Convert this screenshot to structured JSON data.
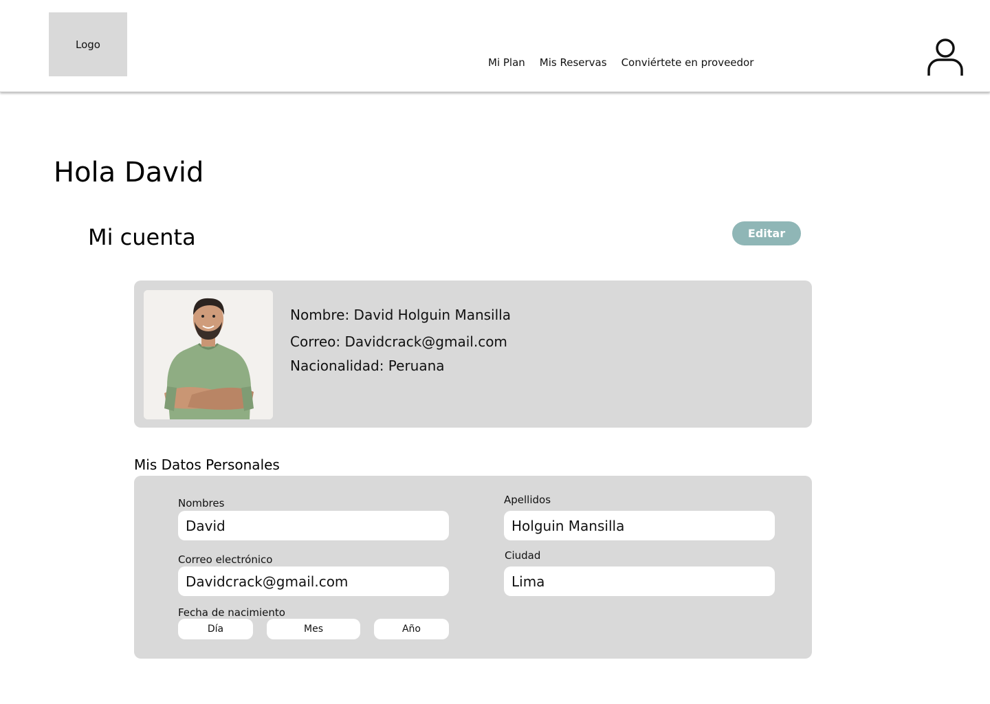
{
  "header": {
    "logo_text": "Logo",
    "nav": [
      {
        "label": "Mi Plan"
      },
      {
        "label": "Mis Reservas"
      },
      {
        "label": "Conviértete en proveedor"
      }
    ],
    "user_icon": "user-icon"
  },
  "greeting": "Hola David",
  "account": {
    "title": "Mi cuenta",
    "edit_label": "Editar",
    "edit_color": "#8fb6b6",
    "name_line": "Nombre: David Holguin Mansilla",
    "email_line": "Correo: Davidcrack@gmail.com",
    "nationality_line": "Nacionalidad: Peruana"
  },
  "personal": {
    "title": "Mis Datos Personales",
    "nombres": {
      "label": "Nombres",
      "value": "David"
    },
    "apellidos": {
      "label": "Apellidos",
      "value": "Holguin Mansilla"
    },
    "correo": {
      "label": "Correo electrónico",
      "value": "Davidcrack@gmail.com"
    },
    "ciudad": {
      "label": "Ciudad",
      "value": "Lima"
    },
    "fecha": {
      "label": "Fecha de nacimiento",
      "dia": "Día",
      "mes": "Mes",
      "anio": "Año"
    }
  }
}
